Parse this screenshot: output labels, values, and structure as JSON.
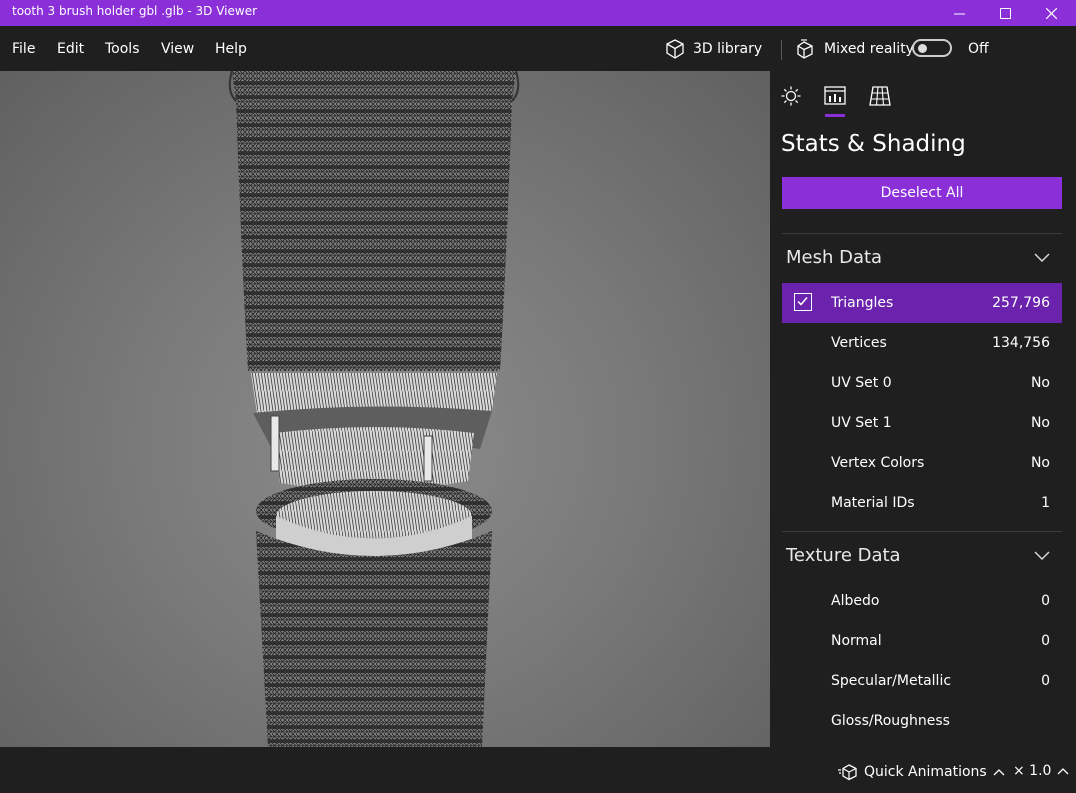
{
  "window": {
    "title": "tooth 3 brush holder gbl .glb - 3D Viewer",
    "minimize_icon": "minimize-icon",
    "maximize_icon": "maximize-icon",
    "close_icon": "close-icon",
    "accent_color": "#8b2fd9"
  },
  "menu": {
    "items": [
      "File",
      "Edit",
      "Tools",
      "View",
      "Help"
    ],
    "library_label": "3D library",
    "mixed_reality_label": "Mixed reality",
    "toggle_state_label": "Off"
  },
  "panel": {
    "tabs": [
      {
        "icon": "lighting-icon",
        "selected": false
      },
      {
        "icon": "stats-icon",
        "selected": true
      },
      {
        "icon": "grid-icon",
        "selected": false
      }
    ],
    "title": "Stats & Shading",
    "deselect_label": "Deselect All",
    "mesh_section": {
      "title": "Mesh Data",
      "rows": [
        {
          "label": "Triangles",
          "value": "257,796",
          "checked": true
        },
        {
          "label": "Vertices",
          "value": "134,756"
        },
        {
          "label": "UV Set 0",
          "value": "No"
        },
        {
          "label": "UV Set 1",
          "value": "No"
        },
        {
          "label": "Vertex Colors",
          "value": "No"
        },
        {
          "label": "Material IDs",
          "value": "1"
        }
      ]
    },
    "texture_section": {
      "title": "Texture Data",
      "rows": [
        {
          "label": "Albedo",
          "value": "0"
        },
        {
          "label": "Normal",
          "value": "0"
        },
        {
          "label": "Specular/Metallic",
          "value": "0"
        },
        {
          "label": "Gloss/Roughness",
          "value": ""
        }
      ]
    }
  },
  "bottom": {
    "quick_animations_label": "Quick Animations",
    "speed_label": "× 1.0"
  }
}
